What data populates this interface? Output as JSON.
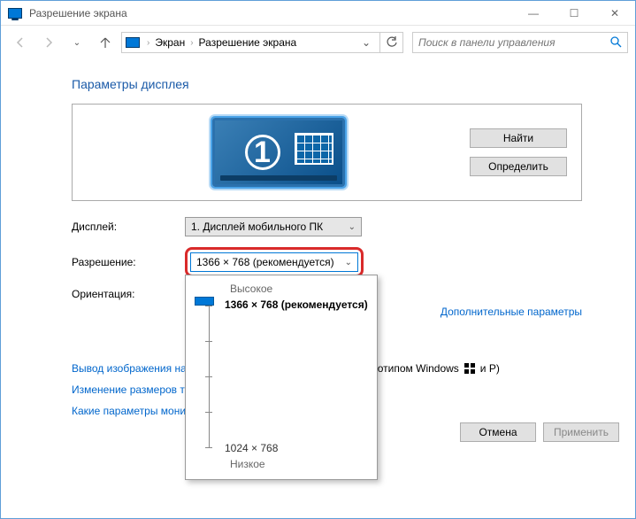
{
  "window": {
    "title": "Разрешение экрана",
    "minimize": "—",
    "maximize": "☐",
    "close": "✕"
  },
  "breadcrumb": {
    "item1": "Экран",
    "item2": "Разрешение экрана"
  },
  "search": {
    "placeholder": "Поиск в панели управления"
  },
  "page": {
    "heading": "Параметры дисплея"
  },
  "preview": {
    "monitor_number": "1",
    "find": "Найти",
    "detect": "Определить"
  },
  "form": {
    "display_label": "Дисплей:",
    "display_value": "1. Дисплей мобильного ПК",
    "resolution_label": "Разрешение:",
    "resolution_value": "1366 × 768 (рекомендуется)",
    "orientation_label": "Ориентация:"
  },
  "dropdown": {
    "high": "Высокое",
    "selected": "1366 × 768 (рекомендуется)",
    "alt": "1024 × 768",
    "low": "Низкое"
  },
  "links": {
    "extra": "Дополнительные параметры",
    "projector_pre": "Вывод изображения на",
    "projector_suf": "отипом Windows",
    "projector_key": "и P)",
    "textsize": "Изменение размеров те",
    "which": "Какие параметры мони"
  },
  "footer": {
    "cancel": "Отмена",
    "apply": "Применить"
  }
}
